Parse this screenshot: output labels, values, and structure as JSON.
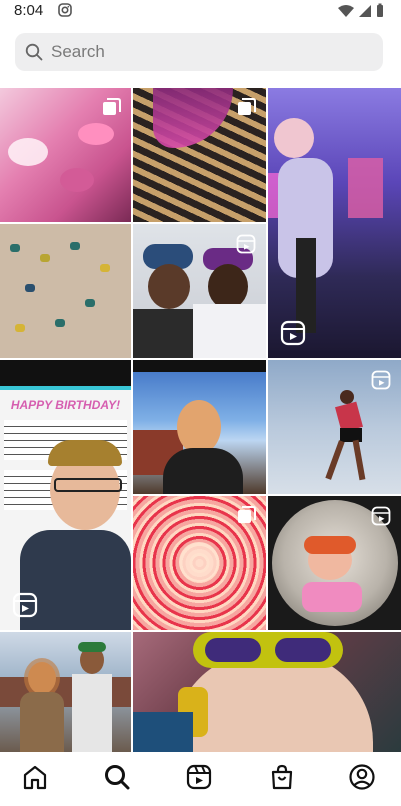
{
  "status_bar": {
    "time": "8:04",
    "camera_icon": "instagram-icon",
    "signal_icons": [
      "wifi-icon",
      "signal-icon",
      "battery-icon"
    ]
  },
  "search": {
    "placeholder": "Search",
    "icon": "search-icon"
  },
  "grid": {
    "tiles": [
      {
        "name": "pink-party-table-post",
        "badge": "carousel-icon"
      },
      {
        "name": "pink-shadow-sculpture-post",
        "badge": "carousel-icon"
      },
      {
        "name": "gaming-room-dance-reel",
        "badge": "reels-icon"
      },
      {
        "name": "climbing-holds-post",
        "badge": ""
      },
      {
        "name": "two-friends-hats-reel",
        "badge": "reels-icon"
      },
      {
        "name": "happy-birthday-sheet-music-reel",
        "badge": "reels-icon",
        "caption": "HAPPY BIRTHDAY!"
      },
      {
        "name": "portrait-leather-jacket-post",
        "badge": ""
      },
      {
        "name": "jump-sky-reel",
        "badge": "reels-icon"
      },
      {
        "name": "pink-red-flower-pattern-post",
        "badge": "carousel-icon"
      },
      {
        "name": "fisheye-selfie-reel",
        "badge": "reels-icon"
      },
      {
        "name": "two-people-fair-post",
        "badge": ""
      },
      {
        "name": "yellow-sunglasses-post",
        "badge": ""
      }
    ]
  },
  "bottom_nav": {
    "items": [
      {
        "name": "home",
        "icon": "home-icon"
      },
      {
        "name": "explore",
        "icon": "search-icon"
      },
      {
        "name": "reels",
        "icon": "reels-icon"
      },
      {
        "name": "shop",
        "icon": "shop-icon"
      },
      {
        "name": "profile",
        "icon": "profile-icon"
      }
    ]
  },
  "colors": {
    "accent_purple": "#7a3dd6",
    "pink": "#e43a8c",
    "search_bg": "#eeeeef"
  }
}
